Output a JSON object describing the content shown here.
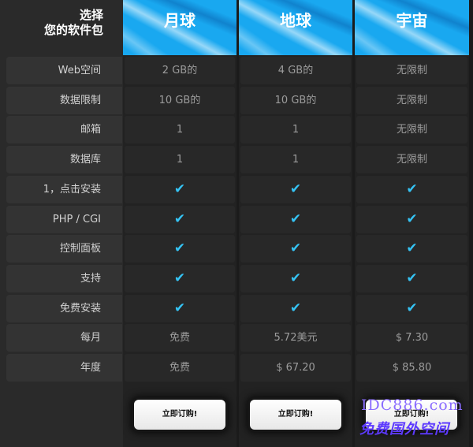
{
  "corner": {
    "line1": "选择",
    "line2": "您的软件包"
  },
  "plans": [
    {
      "name": "月球",
      "button": "立即订购!"
    },
    {
      "name": "地球",
      "button": "立即订购!"
    },
    {
      "name": "宇宙",
      "button": "立即订购!"
    }
  ],
  "rows": [
    {
      "label": "Web空间",
      "values": [
        "2 GB的",
        "4 GB的",
        "无限制"
      ]
    },
    {
      "label": "数据限制",
      "values": [
        "10 GB的",
        "10 GB的",
        "无限制"
      ]
    },
    {
      "label": "邮箱",
      "values": [
        "1",
        "1",
        "无限制"
      ]
    },
    {
      "label": "数据库",
      "values": [
        "1",
        "1",
        "无限制"
      ]
    },
    {
      "label": "1，点击安装",
      "values": [
        "✔",
        "✔",
        "✔"
      ]
    },
    {
      "label": "PHP / CGI",
      "values": [
        "✔",
        "✔",
        "✔"
      ]
    },
    {
      "label": "控制面板",
      "values": [
        "✔",
        "✔",
        "✔"
      ]
    },
    {
      "label": "支持",
      "values": [
        "✔",
        "✔",
        "✔"
      ]
    },
    {
      "label": "免费安装",
      "values": [
        "✔",
        "✔",
        "✔"
      ]
    },
    {
      "label": "每月",
      "values": [
        "免费",
        "5.72美元",
        "$ 7.30"
      ]
    },
    {
      "label": "年度",
      "values": [
        "免费",
        "$ 67.20",
        "$ 85.80"
      ]
    }
  ],
  "watermark": {
    "domain": "IDC886.com",
    "text": "免费国外空间"
  },
  "colors": {
    "header_blue": "#19a8f0",
    "check": "#35c4f5"
  }
}
